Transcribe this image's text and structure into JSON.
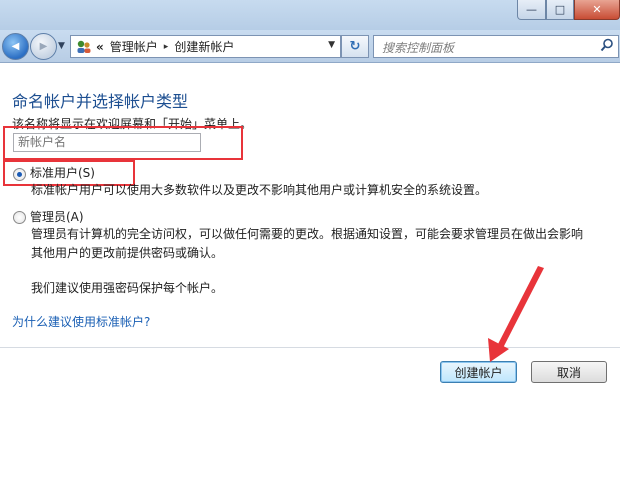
{
  "window": {
    "minimize_glyph": "—",
    "maximize_glyph": "□",
    "close_glyph": "✕"
  },
  "nav": {
    "back_glyph": "◀",
    "forward_glyph": "▶",
    "chevrons": "«",
    "breadcrumb": [
      "管理帐户",
      "创建新帐户"
    ],
    "breadcrumb_separator": "▸",
    "dropdown_glyph": "▼",
    "refresh_glyph": "↻",
    "search_placeholder": "搜索控制面板"
  },
  "main": {
    "heading": "命名帐户并选择帐户类型",
    "description": "该名称将显示在欢迎屏幕和「开始」菜单上。",
    "name_field": {
      "value": "",
      "placeholder": "新帐户名"
    },
    "options": [
      {
        "label": "标准用户(S)",
        "checked": true,
        "text": [
          "标准帐户用户可以使用大多数软件以及更改不影响其他用户或计算机安全的系统设置。"
        ]
      },
      {
        "label": "管理员(A)",
        "checked": false,
        "text": [
          "管理员有计算机的完全访问权，可以做任何需要的更改。根据通知设置，可能会要求管理员在做出会影响",
          "其他用户的更改前提供密码或确认。"
        ]
      }
    ],
    "recommendation": "我们建议使用强密码保护每个帐户。",
    "help_link": "为什么建议使用标准帐户?",
    "buttons": {
      "create": "创建帐户",
      "cancel": "取消"
    }
  },
  "annotation_color": "#e8343a",
  "accent_color": "#1d4f91"
}
